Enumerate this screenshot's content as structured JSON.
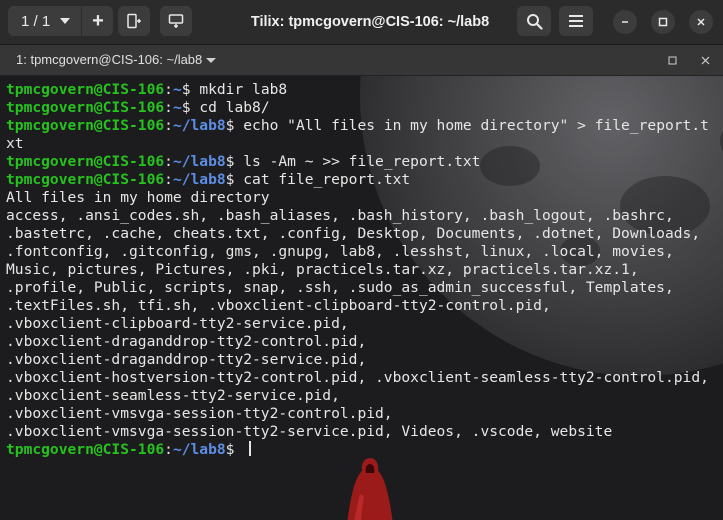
{
  "headerbar": {
    "session_counter": "1 / 1",
    "title": "Tilix: tpmcgovern@CIS-106: ~/lab8",
    "icons": {
      "add_terminal": "plus-icon",
      "add_right": "split-right-icon",
      "add_down": "split-down-icon",
      "search": "search-icon",
      "menu": "hamburger-menu-icon",
      "minimize": "minimize-icon",
      "maximize": "maximize-icon",
      "close": "close-icon"
    }
  },
  "tab": {
    "title": "1: tpmcgovern@CIS-106: ~/lab8"
  },
  "terminal": {
    "colors": {
      "user_host": "#26c21e",
      "path": "#5c8ee6",
      "text": "#e6e6e6"
    },
    "lines": [
      {
        "user": "tpmcgovern@CIS-106",
        "sep": ":",
        "path": "~",
        "cmd": "$ mkdir lab8"
      },
      {
        "user": "tpmcgovern@CIS-106",
        "sep": ":",
        "path": "~",
        "cmd": "$ cd lab8/"
      },
      {
        "user": "tpmcgovern@CIS-106",
        "sep": ":",
        "path": "~/lab8",
        "cmd": "$ echo \"All files in my home directory\" > file_report.t"
      },
      {
        "text": "xt"
      },
      {
        "user": "tpmcgovern@CIS-106",
        "sep": ":",
        "path": "~/lab8",
        "cmd": "$ ls -Am ~ >> file_report.txt"
      },
      {
        "user": "tpmcgovern@CIS-106",
        "sep": ":",
        "path": "~/lab8",
        "cmd": "$ cat file_report.txt"
      },
      {
        "text": "All files in my home directory"
      },
      {
        "text": "access, .ansi_codes.sh, .bash_aliases, .bash_history, .bash_logout, .bashrc,"
      },
      {
        "text": ".bastetrc, .cache, cheats.txt, .config, Desktop, Documents, .dotnet, Downloads,"
      },
      {
        "text": ".fontconfig, .gitconfig, gms, .gnupg, lab8, .lesshst, linux, .local, movies,"
      },
      {
        "text": "Music, pictures, Pictures, .pki, practicels.tar.xz, practicels.tar.xz.1,"
      },
      {
        "text": ".profile, Public, scripts, snap, .ssh, .sudo_as_admin_successful, Templates,"
      },
      {
        "text": ".textFiles.sh, tfi.sh, .vboxclient-clipboard-tty2-control.pid,"
      },
      {
        "text": ".vboxclient-clipboard-tty2-service.pid,"
      },
      {
        "text": ".vboxclient-draganddrop-tty2-control.pid,"
      },
      {
        "text": ".vboxclient-draganddrop-tty2-service.pid,"
      },
      {
        "text": ".vboxclient-hostversion-tty2-control.pid, .vboxclient-seamless-tty2-control.pid,"
      },
      {
        "text": ".vboxclient-seamless-tty2-service.pid,"
      },
      {
        "text": ".vboxclient-vmsvga-session-tty2-control.pid,"
      },
      {
        "text": ".vboxclient-vmsvga-session-tty2-service.pid, Videos, .vscode, website"
      },
      {
        "user": "tpmcgovern@CIS-106",
        "sep": ":",
        "path": "~/lab8",
        "cmd": "$ ",
        "cursor": true
      }
    ]
  }
}
